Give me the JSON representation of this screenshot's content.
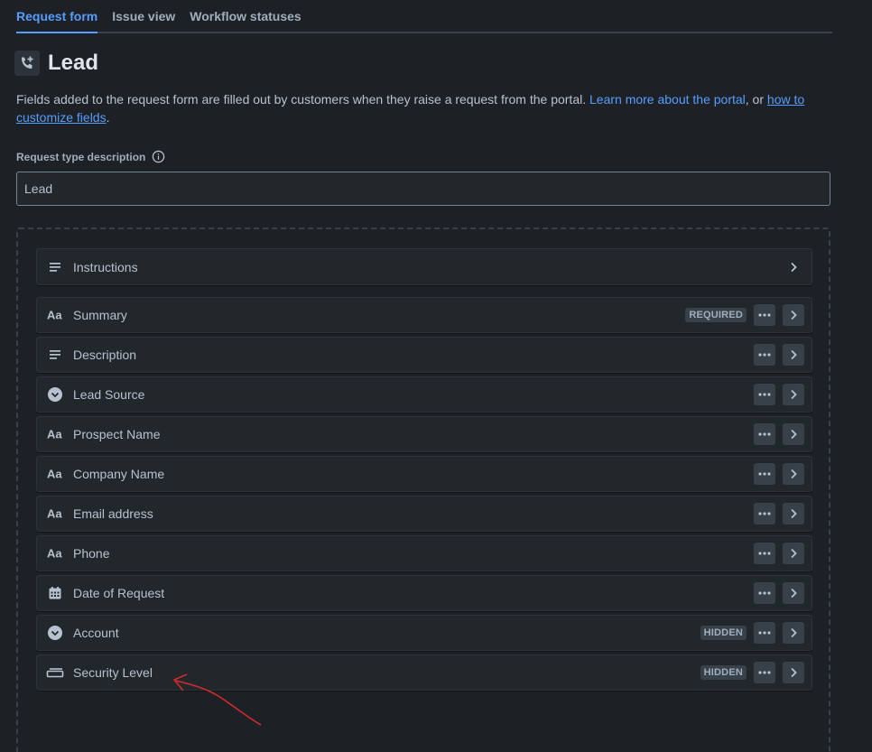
{
  "tabs": [
    {
      "label": "Request form"
    },
    {
      "label": "Issue view"
    },
    {
      "label": "Workflow statuses"
    }
  ],
  "header": {
    "title": "Lead",
    "icon": "phone-plus-icon"
  },
  "intro": {
    "text_before": "Fields added to the request form are filled out by customers when they raise a request from the portal. ",
    "link1": "Learn more about the portal",
    "between": ", or ",
    "link2": "how to customize fields",
    "after": "."
  },
  "description": {
    "label": "Request type description",
    "value": "Lead"
  },
  "instructions": {
    "label": "Instructions",
    "icon": "lines-icon"
  },
  "fields": [
    {
      "label": "Summary",
      "icon": "text-aa-icon",
      "badge": "REQUIRED"
    },
    {
      "label": "Description",
      "icon": "lines-icon",
      "badge": ""
    },
    {
      "label": "Lead Source",
      "icon": "select-icon",
      "badge": ""
    },
    {
      "label": "Prospect Name",
      "icon": "text-aa-icon",
      "badge": ""
    },
    {
      "label": "Company Name",
      "icon": "text-aa-icon",
      "badge": ""
    },
    {
      "label": "Email address",
      "icon": "text-aa-icon",
      "badge": ""
    },
    {
      "label": "Phone",
      "icon": "text-aa-icon",
      "badge": ""
    },
    {
      "label": "Date of Request",
      "icon": "calendar-icon",
      "badge": ""
    },
    {
      "label": "Account",
      "icon": "select-icon",
      "badge": "HIDDEN"
    },
    {
      "label": "Security Level",
      "icon": "security-level-icon",
      "badge": "HIDDEN"
    }
  ],
  "colors": {
    "accent": "#579dff",
    "background": "#1d2125",
    "annotation": "#d12b2b"
  }
}
